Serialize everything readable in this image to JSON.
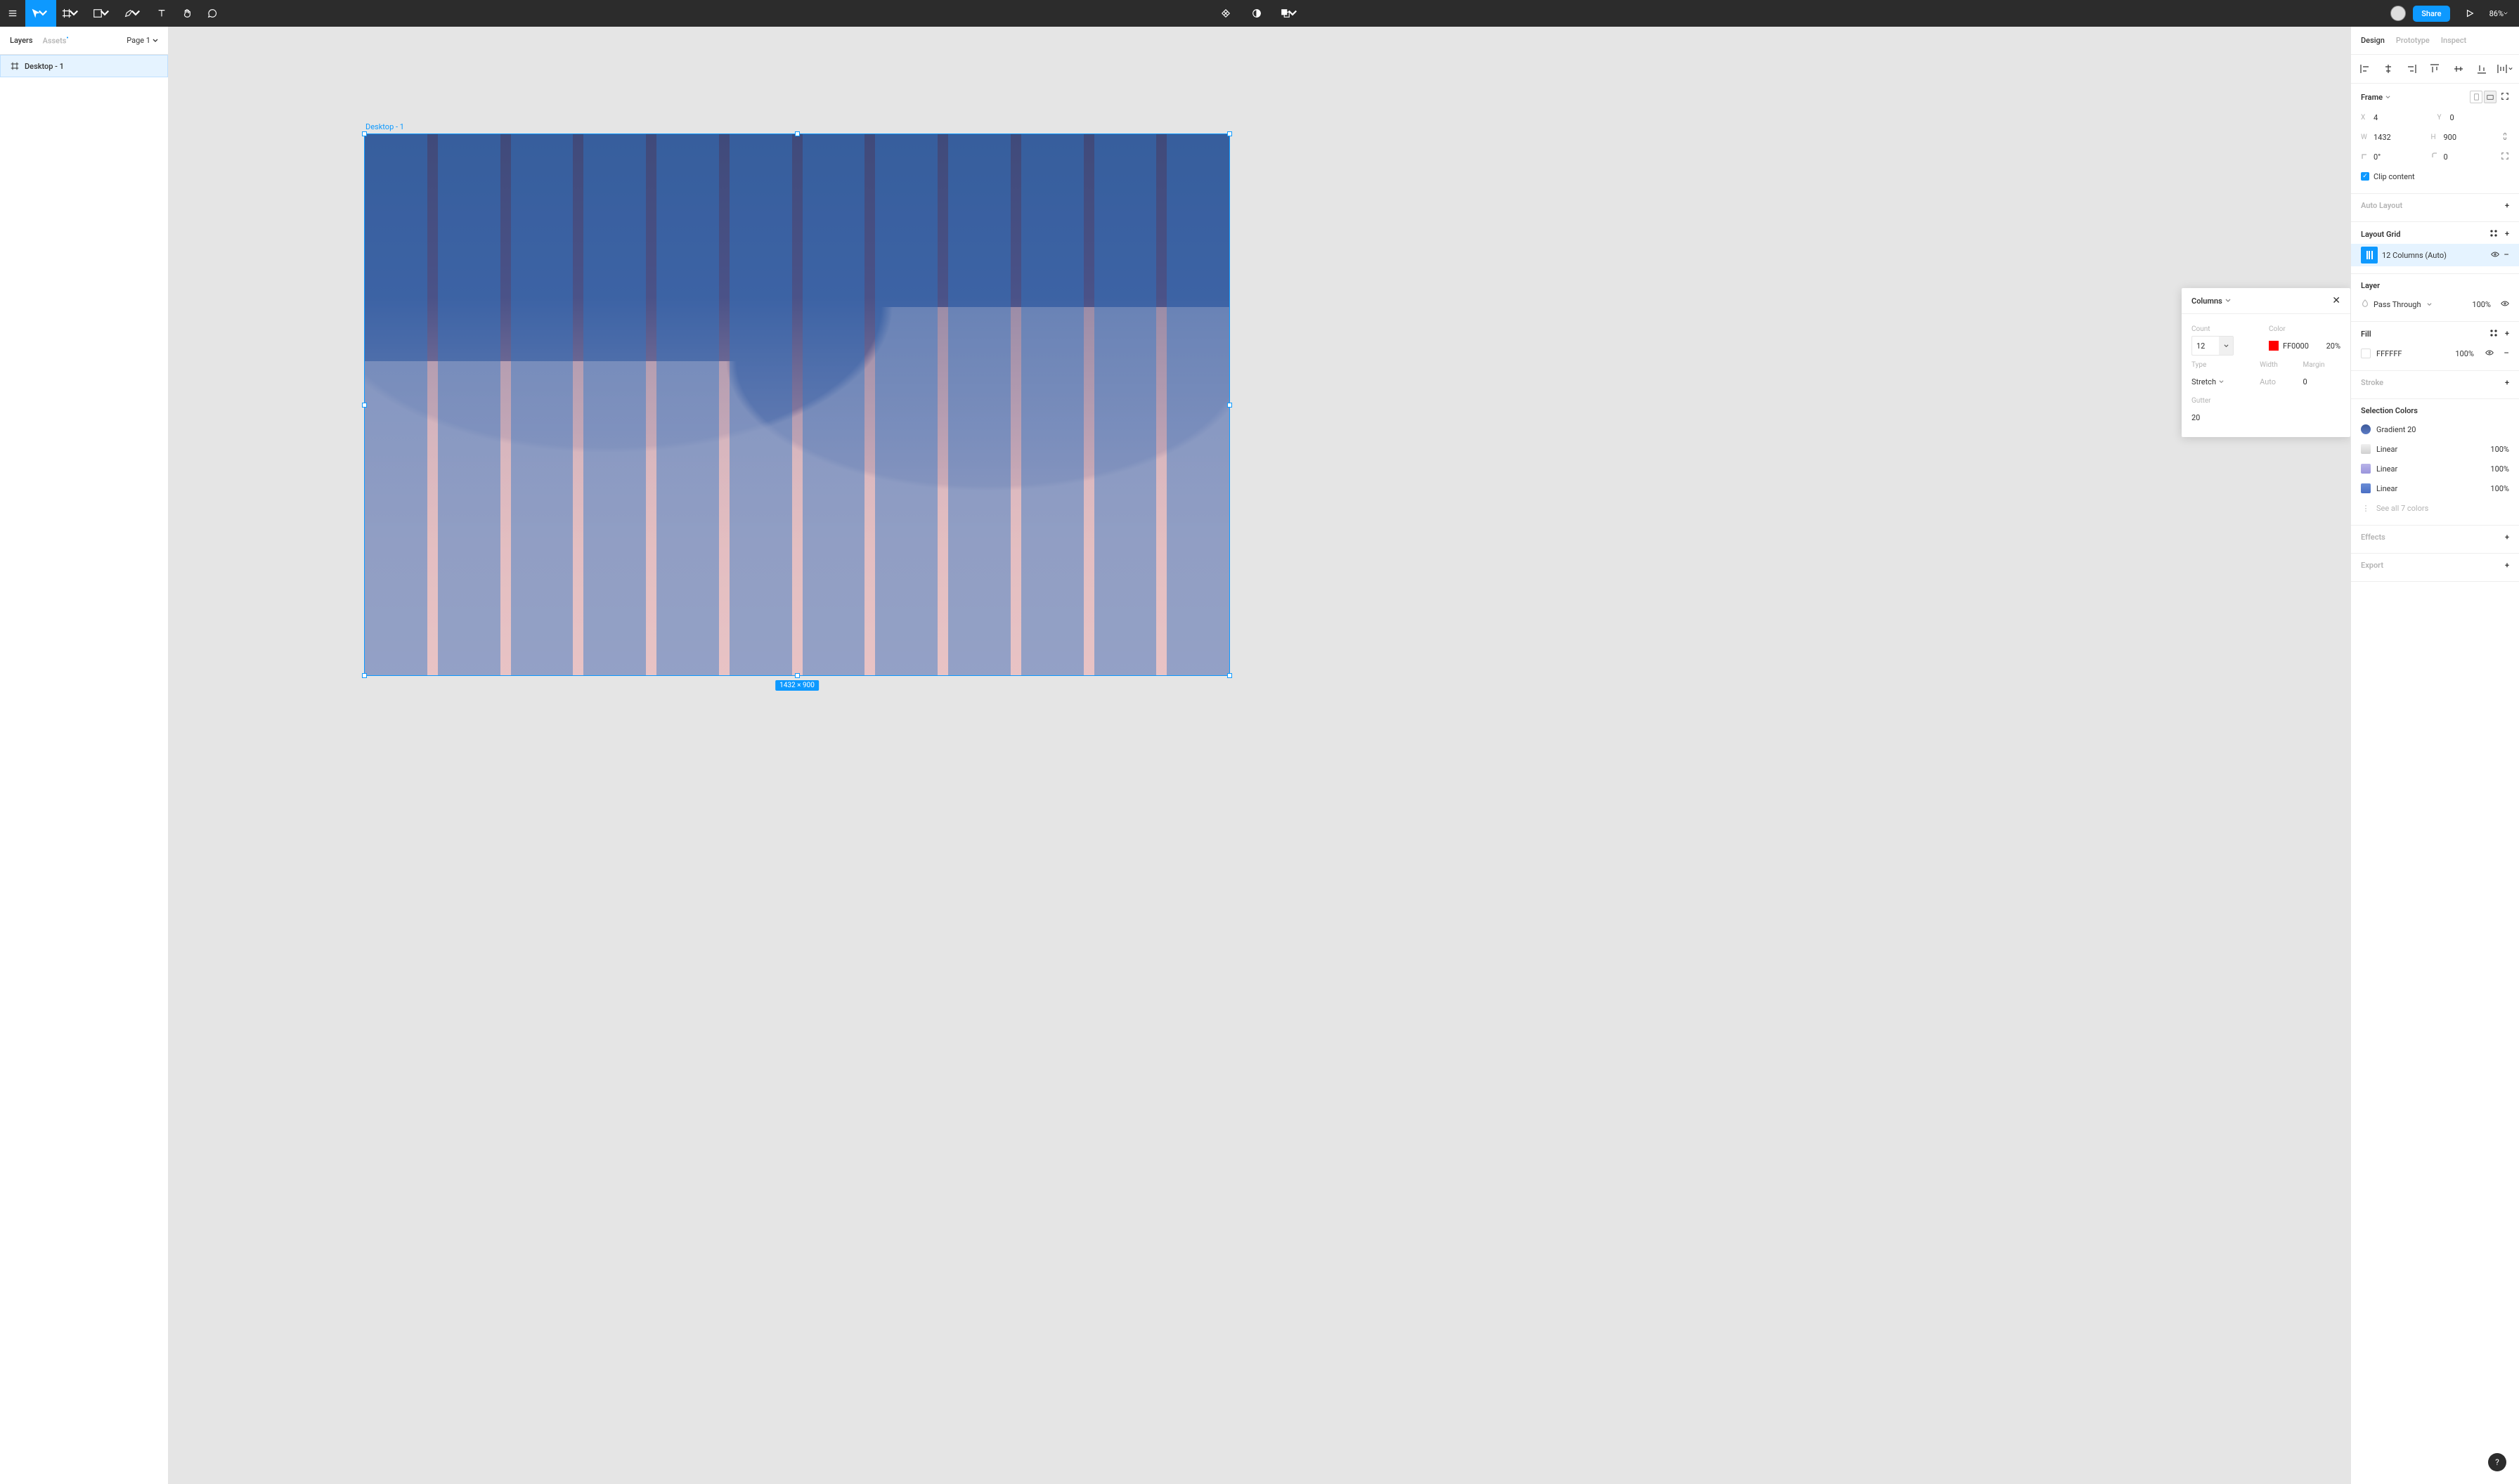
{
  "toolbar": {
    "zoom": "86%",
    "share_label": "Share"
  },
  "left_panel": {
    "tabs": {
      "layers": "Layers",
      "assets": "Assets"
    },
    "page_selector": "Page 1",
    "layers": [
      {
        "name": "Desktop - 1"
      }
    ]
  },
  "canvas": {
    "frame_label": "Desktop - 1",
    "dimensions_badge": "1432 × 900"
  },
  "columns_popover": {
    "title": "Columns",
    "labels": {
      "count": "Count",
      "color": "Color",
      "type": "Type",
      "width": "Width",
      "margin": "Margin",
      "gutter": "Gutter"
    },
    "count": "12",
    "color_hex": "FF0000",
    "color_opacity": "20%",
    "type": "Stretch",
    "width": "Auto",
    "margin": "0",
    "gutter": "20"
  },
  "right_panel": {
    "tabs": {
      "design": "Design",
      "prototype": "Prototype",
      "inspect": "Inspect"
    },
    "frame": {
      "header": "Frame",
      "x_label": "X",
      "x": "4",
      "y_label": "Y",
      "y": "0",
      "w_label": "W",
      "w": "1432",
      "h_label": "H",
      "h": "900",
      "rotation": "0°",
      "corner": "0",
      "clip_content": "Clip content"
    },
    "auto_layout": {
      "header": "Auto Layout"
    },
    "layout_grid": {
      "header": "Layout Grid",
      "item": "12 Columns (Auto)"
    },
    "layer": {
      "header": "Layer",
      "blend": "Pass Through",
      "opacity": "100%"
    },
    "fill": {
      "header": "Fill",
      "hex": "FFFFFF",
      "opacity": "100%"
    },
    "stroke": {
      "header": "Stroke"
    },
    "selection_colors": {
      "header": "Selection Colors",
      "items": [
        {
          "label": "Gradient 20",
          "pct": "",
          "sw": "linear-gradient(180deg,#3d5a9a,#5b7bc4)"
        },
        {
          "label": "Linear",
          "pct": "100%",
          "sw": "linear-gradient(180deg,#f0f0f0,#d0d0d0)"
        },
        {
          "label": "Linear",
          "pct": "100%",
          "sw": "linear-gradient(180deg,#b8b4e8,#9a94dc)"
        },
        {
          "label": "Linear",
          "pct": "100%",
          "sw": "linear-gradient(180deg,#6b8dd6,#4a6fc4)"
        }
      ],
      "see_all": "See all 7 colors"
    },
    "effects": {
      "header": "Effects"
    },
    "export": {
      "header": "Export"
    }
  }
}
